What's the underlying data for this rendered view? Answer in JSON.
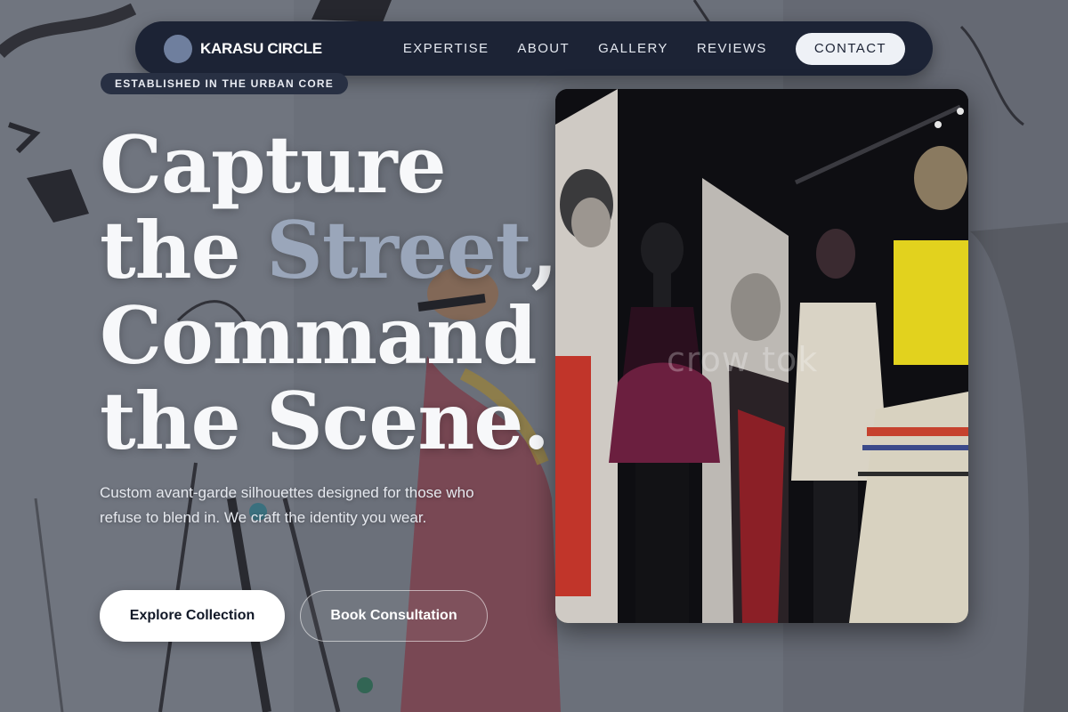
{
  "brand": {
    "name": "KARASU CIRCLE",
    "logo_icon": "circle-logo-icon"
  },
  "nav": {
    "links": [
      "EXPERTISE",
      "ABOUT",
      "GALLERY",
      "REVIEWS"
    ],
    "cta": "CONTACT"
  },
  "hero": {
    "badge": "ESTABLISHED IN THE URBAN CORE",
    "headline": {
      "line1": "Capture",
      "line2_a": "the ",
      "line2_accent": "Street",
      "line2_b": ",",
      "line3": "Command",
      "line4": "the Scene."
    },
    "subtext": "Custom avant-garde silhouettes designed for those who refuse to blend in. We craft the identity you wear.",
    "primary_button": "Explore Collection",
    "secondary_button": "Book Consultation"
  },
  "photo": {
    "watermark": "crow tok",
    "subject": "fashion exhibition mannequins"
  },
  "colors": {
    "nav_bg": "#1c2335",
    "accent_text": "#9aa6ba",
    "brand_dot": "#6f7f9e",
    "button_bg": "#ffffff"
  }
}
